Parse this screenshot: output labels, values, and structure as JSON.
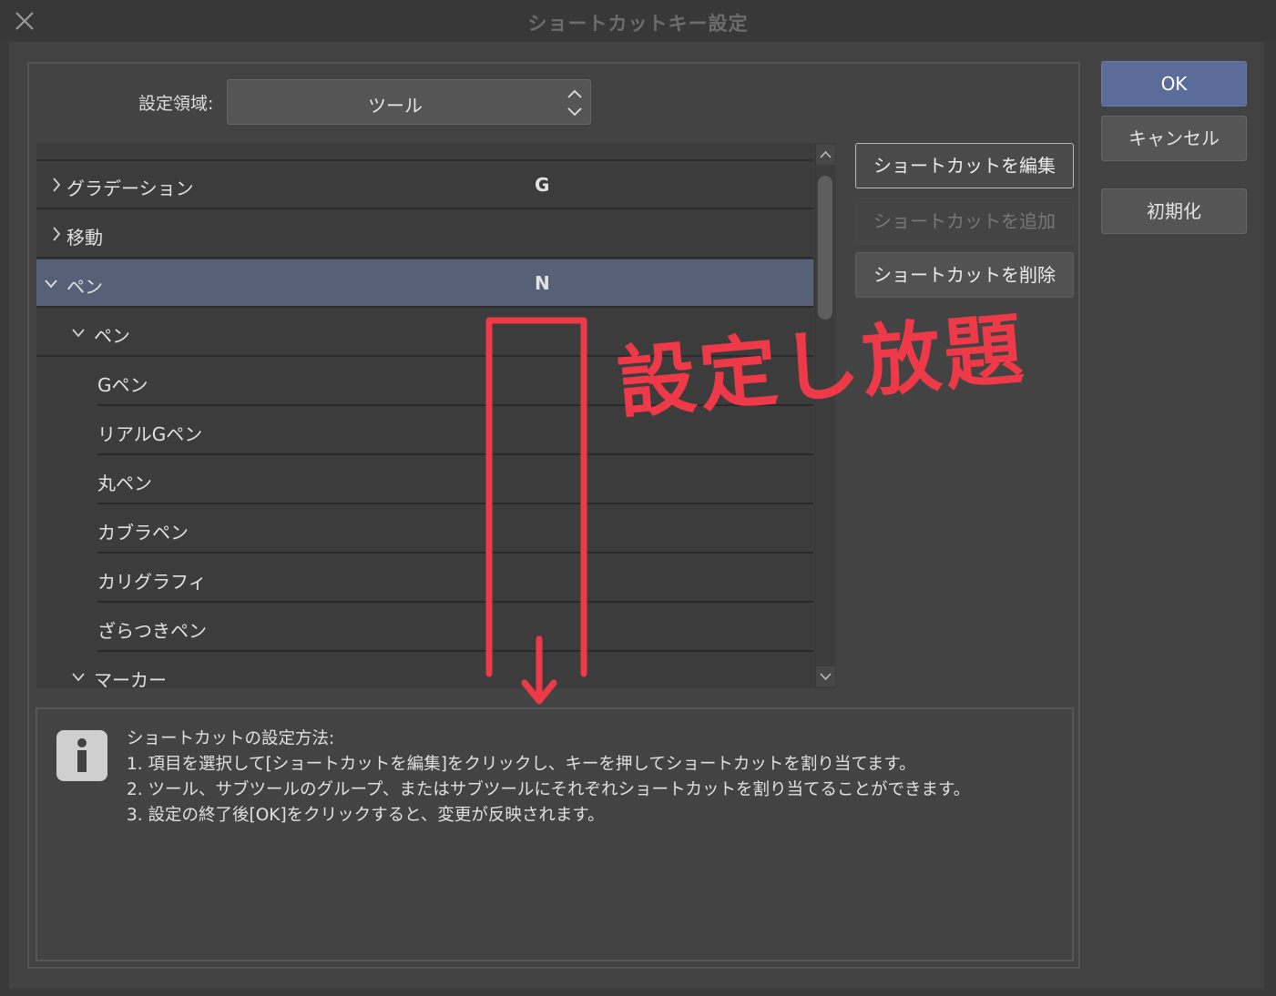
{
  "window": {
    "title": "ショートカットキー設定"
  },
  "settings_area": {
    "label": "設定領域:",
    "value": "ツール"
  },
  "tree": {
    "rows": [
      {
        "label": "グラデーション",
        "key": "G",
        "expanded": false
      },
      {
        "label": "移動",
        "key": "",
        "expanded": false
      },
      {
        "label": "ペン",
        "key": "N",
        "expanded": true,
        "selected": true
      },
      {
        "label": "ペン",
        "key": "",
        "expanded": true
      },
      {
        "label": "Gペン",
        "key": ""
      },
      {
        "label": "リアルGペン",
        "key": ""
      },
      {
        "label": "丸ペン",
        "key": ""
      },
      {
        "label": "カブラペン",
        "key": ""
      },
      {
        "label": "カリグラフィ",
        "key": ""
      },
      {
        "label": "ざらつきペン",
        "key": ""
      },
      {
        "label": "マーカー",
        "key": "",
        "expanded": true
      }
    ]
  },
  "shortcut_buttons": {
    "edit": "ショートカットを編集",
    "add": "ショートカットを追加",
    "delete": "ショートカットを削除"
  },
  "dialog_buttons": {
    "ok": "OK",
    "cancel": "キャンセル",
    "reset": "初期化"
  },
  "info": {
    "heading": "ショートカットの設定方法:",
    "line1": "1. 項目を選択して[ショートカットを編集]をクリックし、キーを押してショートカットを割り当てます。",
    "line2": "2. ツール、サブツールのグループ、またはサブツールにそれぞれショートカットを割り当てることができます。",
    "line3": "3. 設定の終了後[OK]をクリックすると、変更が反映されます。"
  },
  "annotation": {
    "handwritten_text": "設定し放題",
    "color": "#ee3a48"
  },
  "colors": {
    "selected_row": "#566178",
    "ok_button": "#5b6c9a"
  }
}
